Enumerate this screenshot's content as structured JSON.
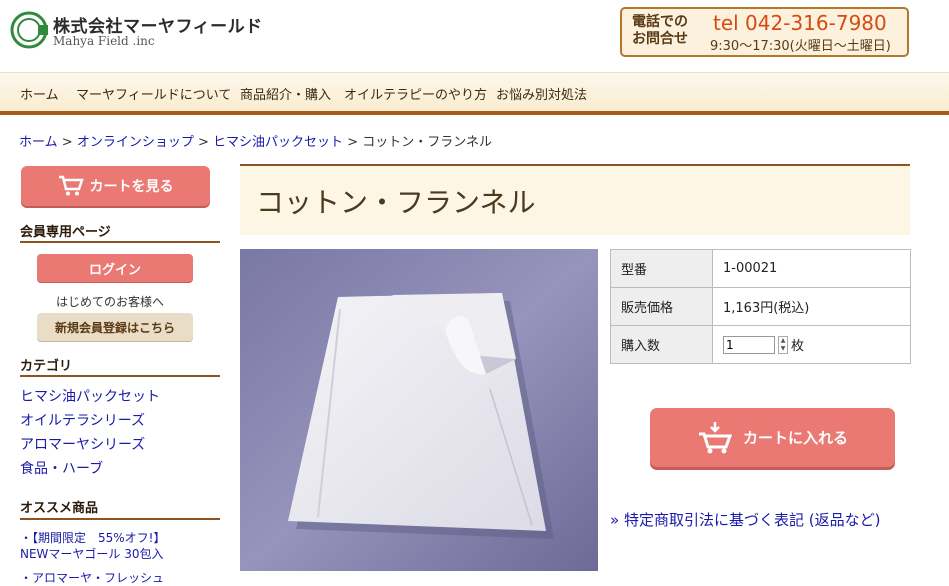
{
  "header": {
    "company_name": "株式会社マーヤフィールド",
    "company_sub": "Mahya Field .inc",
    "contact_label_1": "電話での",
    "contact_label_2": "お問合せ",
    "phone": "tel 042-316-7980",
    "hours": "9:30〜17:30(火曜日〜土曜日)"
  },
  "nav": {
    "items": [
      "ホーム",
      "マーヤフィールドについて",
      "商品紹介・購入",
      "オイルテラピーのやり方",
      "お悩み別対処法"
    ]
  },
  "breadcrumb": {
    "items": [
      "ホーム",
      "オンラインショップ",
      "ヒマシ油パックセット"
    ],
    "separator": ">",
    "current": "コットン・フランネル"
  },
  "sidebar": {
    "cart_button": "カートを見る",
    "members_heading": "会員専用ページ",
    "login_button": "ログイン",
    "first_visit": "はじめてのお客様へ",
    "register_button": "新規会員登録はこちら",
    "category_heading": "カテゴリ",
    "categories": [
      "ヒマシ油パックセット",
      "オイルテラシリーズ",
      "アロマーヤシリーズ",
      "食品・ハーブ"
    ],
    "recommend_heading": "オススメ商品",
    "recommended": [
      "・【期間限定　55%オフ!】",
      "NEWマーヤゴール 30包入",
      "・アロマーヤ・フレッシュ"
    ]
  },
  "product": {
    "title": "コットン・フランネル",
    "model_label": "型番",
    "model_value": "1-00021",
    "price_label": "販売価格",
    "price_value": "1,163円(税込)",
    "qty_label": "購入数",
    "qty_value": "1",
    "qty_unit": "枚",
    "add_to_cart": "カートに入れる",
    "law_link": "» 特定商取引法に基づく表記 (返品など)"
  },
  "colors": {
    "brand_brown": "#8c5423",
    "cart_button": "#ea7873",
    "phone_accent": "#d64b12",
    "link": "#1a1aa8",
    "logo_green": "#2f8a3c"
  }
}
